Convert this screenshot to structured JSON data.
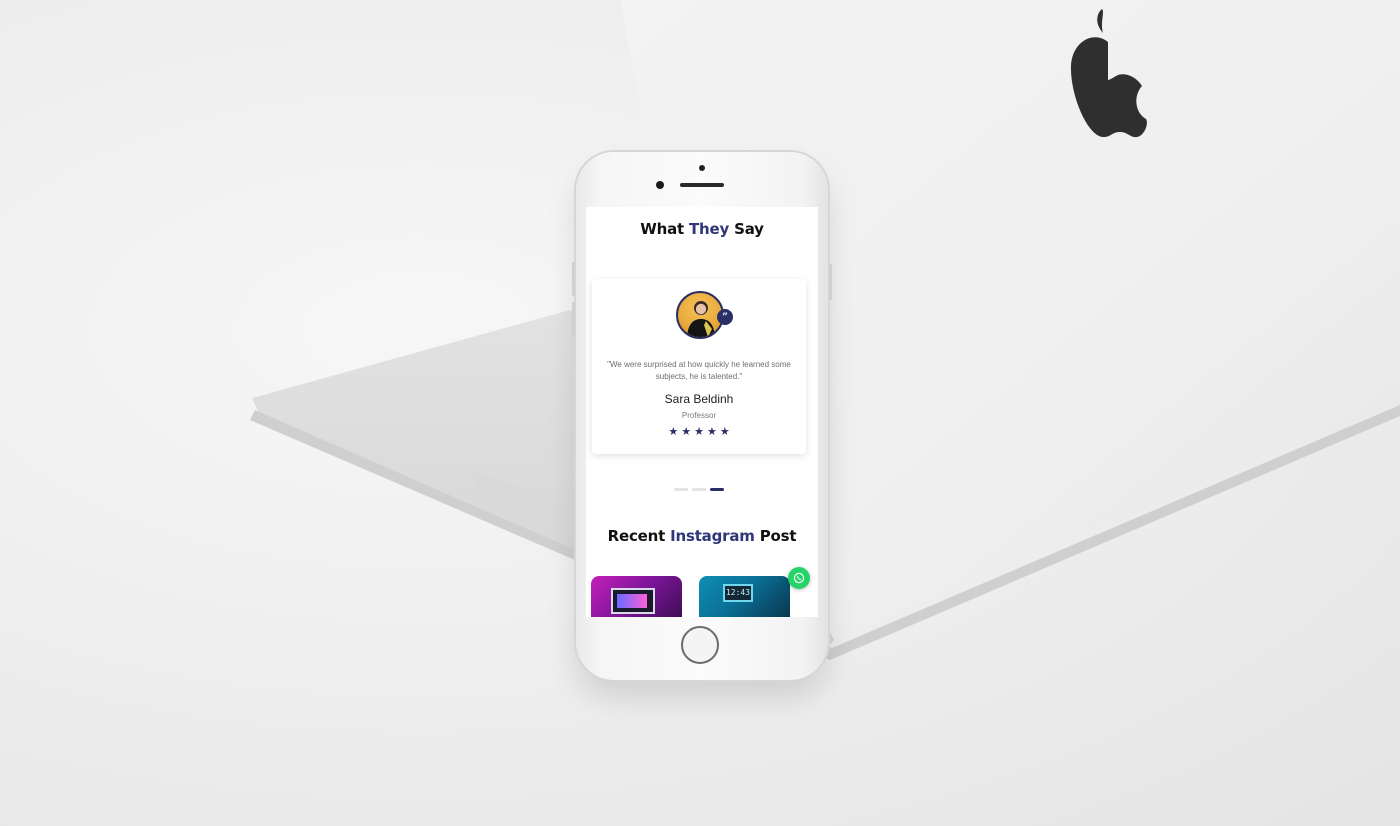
{
  "testimonials": {
    "title_parts": [
      "What ",
      "They",
      " Say"
    ],
    "quote_badge": "”",
    "quote": "\"We were surprised at how quickly he learned some subjects, he is talented.\"",
    "author": "Sara Beldinh",
    "role": "Professor",
    "rating": 5,
    "star_glyph": "★",
    "slider_dots": 3,
    "active_dot": 3
  },
  "instagram": {
    "title_parts": [
      "Recent ",
      "Instagram",
      " Post"
    ],
    "posts": [
      {
        "label": ""
      },
      {
        "label": "12:43"
      }
    ]
  },
  "icons": {
    "avatar": "person-avatar-icon",
    "quote": "quote-icon",
    "whatsapp": "whatsapp-icon",
    "apple_logo": "apple-logo-icon"
  },
  "colors": {
    "accent": "#2f3778",
    "whatsapp": "#25d366",
    "star": "#2a2f66"
  }
}
